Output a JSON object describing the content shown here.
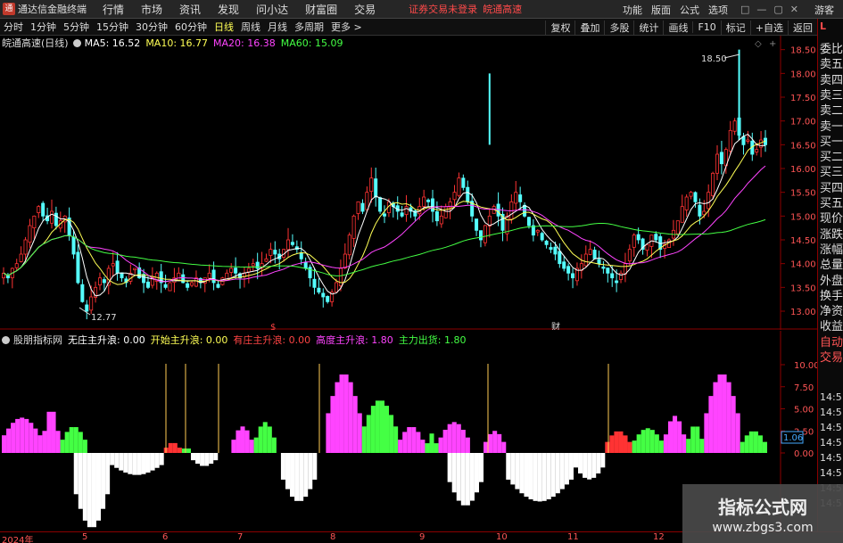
{
  "menubar": {
    "app_title": "通达信金融终端",
    "items": [
      "行情",
      "市场",
      "资讯",
      "发现",
      "问小达",
      "财富圈",
      "交易"
    ],
    "warning": "证券交易未登录",
    "stock": "皖通高速",
    "right_items": [
      "功能",
      "版面",
      "公式",
      "选项"
    ],
    "guest": "游客",
    "win_controls": [
      "□",
      "—",
      "▢",
      "✕"
    ]
  },
  "toolbar": {
    "periods": [
      "分时",
      "1分钟",
      "5分钟",
      "15分钟",
      "30分钟",
      "60分钟",
      "日线",
      "周线",
      "月线",
      "多周期",
      "更多 >"
    ],
    "active_period": "日线",
    "right_buttons": [
      "复权",
      "叠加",
      "多股",
      "统计",
      "画线",
      "F10",
      "标记",
      "+自选",
      "返回"
    ]
  },
  "price_legend": {
    "title": "皖通高速(日线)",
    "ma5_label": "MA5: 16.52",
    "ma10_label": "MA10: 16.77",
    "ma20_label": "MA20: 16.38",
    "ma60_label": "MA60: 15.09",
    "colors": {
      "ma5": "#ffffff",
      "ma10": "#ffff55",
      "ma20": "#ff44ff",
      "ma60": "#44ff44"
    }
  },
  "indicator_legend": {
    "title": "股朋指标网",
    "items": [
      {
        "label": "无庄主升浪: 0.00",
        "color": "#ffffff"
      },
      {
        "label": "开始主升浪: 0.00",
        "color": "#ffff55"
      },
      {
        "label": "有庄主升浪: 0.00",
        "color": "#ff4444"
      },
      {
        "label": "高度主升浪: 1.80",
        "color": "#ff44ff"
      },
      {
        "label": "主力出货: 1.80",
        "color": "#44ff44"
      }
    ]
  },
  "price_axis": {
    "ticks": [
      "18.50",
      "18.00",
      "17.50",
      "17.00",
      "16.50",
      "16.00",
      "15.50",
      "15.00",
      "14.50",
      "14.00",
      "13.50",
      "13.00"
    ]
  },
  "indicator_axis": {
    "ticks": [
      "10.00",
      "7.50",
      "5.00",
      "2.50",
      "0.00"
    ],
    "current": "1.06"
  },
  "annotations": {
    "high": "18.50",
    "low": "12.77",
    "mark_s": "$",
    "mark_cai": "财"
  },
  "date_axis": {
    "labels": [
      "2024年",
      "5",
      "6",
      "7",
      "8",
      "9",
      "10",
      "11",
      "12"
    ]
  },
  "quote_panel": {
    "l_label": "L",
    "items": [
      "委比",
      "卖五",
      "卖四",
      "卖三",
      "卖二",
      "卖一",
      "买一",
      "买二",
      "买三",
      "买四",
      "买五",
      "现价",
      "涨跌",
      "涨幅",
      "总量",
      "外盘",
      "换手",
      "净资",
      "收益",
      "自动",
      "交易"
    ],
    "times": [
      "14:5",
      "14:5",
      "14:5",
      "14:5",
      "14:5",
      "14:5",
      "14:5",
      "14:5"
    ]
  },
  "watermark": {
    "title": "指标公式网",
    "url": "www.zbgs3.com"
  },
  "chart_data": {
    "type": "candlestick",
    "ylim": [
      12.7,
      18.7
    ],
    "closes": [
      13.8,
      13.7,
      13.9,
      14.0,
      14.2,
      14.5,
      14.8,
      15.0,
      15.2,
      15.0,
      14.9,
      15.1,
      14.8,
      14.9,
      15.0,
      14.6,
      14.2,
      13.6,
      13.2,
      13.0,
      13.3,
      13.5,
      13.7,
      13.6,
      13.9,
      14.0,
      13.8,
      13.7,
      13.6,
      13.8,
      13.9,
      13.7,
      13.6,
      13.5,
      13.7,
      13.8,
      13.6,
      13.5,
      13.6,
      13.7,
      13.8,
      13.6,
      13.5,
      13.6,
      13.7,
      13.6,
      13.7,
      13.8,
      13.6,
      13.5,
      13.7,
      13.8,
      13.9,
      13.8,
      13.7,
      13.8,
      13.9,
      14.0,
      13.9,
      14.0,
      14.1,
      14.3,
      14.2,
      14.1,
      14.3,
      14.5,
      14.4,
      14.3,
      14.1,
      13.9,
      13.7,
      13.5,
      13.4,
      13.3,
      13.2,
      13.4,
      13.6,
      13.9,
      14.2,
      14.6,
      15.0,
      15.3,
      15.1,
      15.5,
      15.8,
      15.4,
      15.1,
      15.0,
      15.3,
      15.2,
      15.1,
      15.0,
      15.2,
      15.1,
      15.0,
      15.2,
      15.4,
      15.3,
      15.1,
      14.9,
      15.0,
      15.2,
      15.3,
      15.5,
      15.8,
      15.6,
      15.3,
      15.0,
      14.7,
      14.5,
      14.8,
      15.0,
      15.2,
      15.0,
      14.7,
      15.0,
      15.3,
      15.5,
      15.3,
      15.0,
      14.8,
      14.6,
      14.7,
      14.5,
      14.4,
      14.3,
      14.2,
      14.0,
      13.9,
      13.8,
      13.7,
      13.9,
      14.0,
      14.2,
      14.3,
      14.1,
      14.0,
      13.9,
      13.8,
      13.7,
      13.6,
      13.8,
      14.0,
      14.3,
      14.6,
      14.5,
      14.3,
      14.4,
      14.6,
      14.5,
      14.3,
      14.4,
      14.5,
      14.7,
      14.9,
      15.2,
      15.4,
      15.5,
      15.3,
      15.0,
      15.1,
      15.5,
      15.9,
      16.3,
      16.1,
      16.4,
      16.8,
      17.0,
      16.7,
      16.5,
      16.6,
      16.3,
      16.4,
      16.6,
      16.5
    ]
  }
}
